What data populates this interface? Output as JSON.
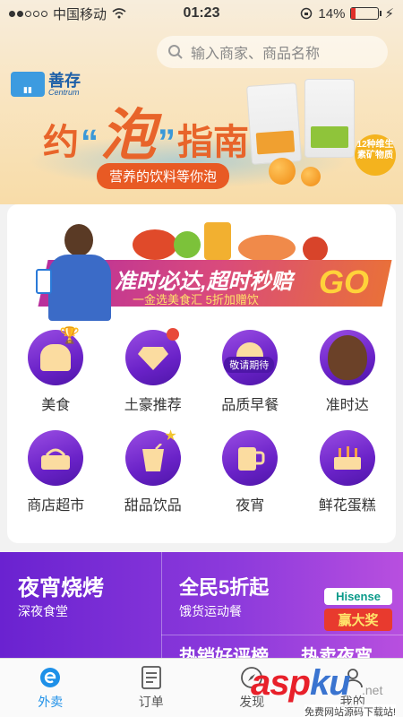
{
  "status_bar": {
    "carrier": "中国移动",
    "time": "01:23",
    "battery": "14%",
    "battery_level": 0.14
  },
  "search": {
    "placeholder": "输入商家、商品名称"
  },
  "hero_banner": {
    "brand_cn": "善存",
    "brand_en": "Centrum",
    "title_part1": "约",
    "title_quote_open": "“",
    "title_highlight": "泡",
    "title_quote_close": "”",
    "title_part2": "指南",
    "subtitle": "营养的饮料等你泡",
    "vitamin_badge": "12种维生素矿物质"
  },
  "promo_banner": {
    "title": "准时必达,超时秒赔",
    "subtitle": "一金选美食汇 5折加赠饮",
    "go_text": "GO"
  },
  "categories": [
    {
      "label": "美食",
      "icon": "food-icon"
    },
    {
      "label": "土豪推荐",
      "icon": "diamond-icon"
    },
    {
      "label": "品质早餐",
      "icon": "breakfast-icon",
      "badge": "敬请期待"
    },
    {
      "label": "准时达",
      "icon": "ontime-icon"
    },
    {
      "label": "商店超市",
      "icon": "basket-icon"
    },
    {
      "label": "甜品饮品",
      "icon": "drink-icon"
    },
    {
      "label": "夜宵",
      "icon": "beer-icon"
    },
    {
      "label": "鲜花蛋糕",
      "icon": "cake-icon"
    }
  ],
  "bottom_promo": {
    "title1": "夜宵烧烤",
    "sub1": "深夜食堂",
    "title2": "全民5折起",
    "sub2": "饿货运动餐",
    "hisense": "Hisense",
    "prize": "赢大奖",
    "title3": "热销好评榜",
    "title4": "热卖夜宵"
  },
  "nav": {
    "items": [
      "外卖",
      "订单",
      "发现",
      "我的"
    ]
  },
  "watermark": {
    "main": "asp",
    "ku": "ku",
    "net": ".net",
    "footer": "免费网站源码下载站!"
  },
  "colors": {
    "accent_blue": "#1e90e8",
    "category_purple": "#6a22c8",
    "promo_orange": "#e8642a"
  }
}
